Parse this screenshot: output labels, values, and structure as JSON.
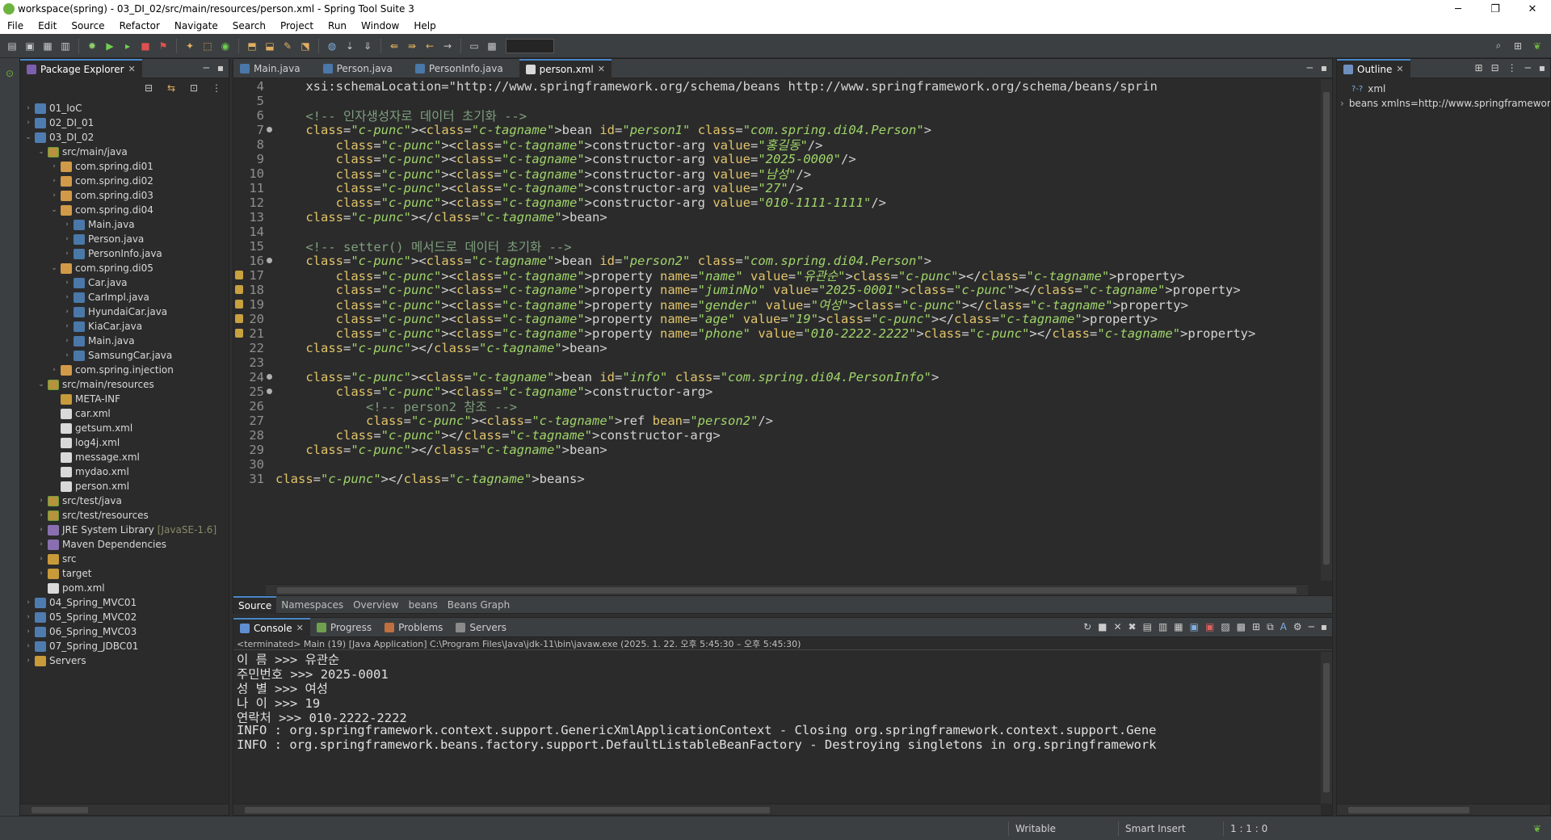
{
  "window": {
    "title": "workspace(spring) - 03_DI_02/src/main/resources/person.xml - Spring Tool Suite 3",
    "minimize": "─",
    "maximize": "❐",
    "close": "✕"
  },
  "menu": [
    "File",
    "Edit",
    "Source",
    "Refactor",
    "Navigate",
    "Search",
    "Project",
    "Run",
    "Window",
    "Help"
  ],
  "package_explorer": {
    "title": "Package Explorer",
    "tree": [
      {
        "label": "01_IoC",
        "icon": "project-icon",
        "twisty": "›"
      },
      {
        "label": "02_DI_01",
        "icon": "project-icon",
        "twisty": "›"
      },
      {
        "label": "03_DI_02",
        "icon": "project-icon",
        "twisty": "⌄"
      },
      {
        "label": "src/main/java",
        "icon": "source-folder-icon",
        "twisty": "⌄"
      },
      {
        "label": "com.spring.di01",
        "icon": "package-icon",
        "twisty": "›"
      },
      {
        "label": "com.spring.di02",
        "icon": "package-icon",
        "twisty": "›"
      },
      {
        "label": "com.spring.di03",
        "icon": "package-icon",
        "twisty": "›"
      },
      {
        "label": "com.spring.di04",
        "icon": "package-icon",
        "twisty": "⌄"
      },
      {
        "label": "Main.java",
        "icon": "java-file-icon",
        "twisty": "›"
      },
      {
        "label": "Person.java",
        "icon": "java-file-icon",
        "twisty": "›"
      },
      {
        "label": "PersonInfo.java",
        "icon": "java-file-icon",
        "twisty": "›"
      },
      {
        "label": "com.spring.di05",
        "icon": "package-icon",
        "twisty": "⌄"
      },
      {
        "label": "Car.java",
        "icon": "java-file-icon",
        "twisty": "›"
      },
      {
        "label": "CarImpl.java",
        "icon": "java-file-icon",
        "twisty": "›"
      },
      {
        "label": "HyundaiCar.java",
        "icon": "java-file-icon",
        "twisty": "›"
      },
      {
        "label": "KiaCar.java",
        "icon": "java-file-icon",
        "twisty": "›"
      },
      {
        "label": "Main.java",
        "icon": "java-file-icon",
        "twisty": "›"
      },
      {
        "label": "SamsungCar.java",
        "icon": "java-file-icon",
        "twisty": "›"
      },
      {
        "label": "com.spring.injection",
        "icon": "package-icon",
        "twisty": "›"
      },
      {
        "label": "src/main/resources",
        "icon": "source-folder-icon",
        "twisty": "⌄"
      },
      {
        "label": "META-INF",
        "icon": "folder-icon",
        "twisty": ""
      },
      {
        "label": "car.xml",
        "icon": "xml-file-icon",
        "twisty": ""
      },
      {
        "label": "getsum.xml",
        "icon": "xml-file-icon",
        "twisty": ""
      },
      {
        "label": "log4j.xml",
        "icon": "xml-file-icon",
        "twisty": ""
      },
      {
        "label": "message.xml",
        "icon": "xml-file-icon",
        "twisty": ""
      },
      {
        "label": "mydao.xml",
        "icon": "xml-file-icon",
        "twisty": ""
      },
      {
        "label": "person.xml",
        "icon": "xml-file-icon",
        "twisty": ""
      },
      {
        "label": "src/test/java",
        "icon": "source-folder-icon",
        "twisty": "›"
      },
      {
        "label": "src/test/resources",
        "icon": "source-folder-icon",
        "twisty": "›"
      },
      {
        "label": "JRE System Library",
        "suffix": "[JavaSE-1.6]",
        "icon": "library-icon",
        "twisty": "›"
      },
      {
        "label": "Maven Dependencies",
        "icon": "library-icon",
        "twisty": "›"
      },
      {
        "label": "src",
        "icon": "folder-icon",
        "twisty": "›"
      },
      {
        "label": "target",
        "icon": "folder-icon",
        "twisty": "›"
      },
      {
        "label": "pom.xml",
        "icon": "xml-file-icon",
        "twisty": ""
      },
      {
        "label": "04_Spring_MVC01",
        "icon": "project-icon",
        "twisty": "›"
      },
      {
        "label": "05_Spring_MVC02",
        "icon": "project-icon",
        "twisty": "›"
      },
      {
        "label": "06_Spring_MVC03",
        "icon": "project-icon",
        "twisty": "›"
      },
      {
        "label": "07_Spring_JDBC01",
        "icon": "project-icon",
        "twisty": "›"
      },
      {
        "label": "Servers",
        "icon": "folder-icon",
        "twisty": "›"
      }
    ]
  },
  "editor": {
    "tabs": [
      {
        "label": "Main.java",
        "icon": "java-file-icon",
        "active": false
      },
      {
        "label": "Person.java",
        "icon": "java-file-icon",
        "active": false
      },
      {
        "label": "PersonInfo.java",
        "icon": "java-file-icon",
        "active": false
      },
      {
        "label": "person.xml",
        "icon": "xml-file-icon",
        "active": true
      }
    ],
    "lines": [
      {
        "n": "4",
        "text": "    xsi:schemaLocation=\"http://www.springframework.org/schema/beans http://www.springframework.org/schema/beans/sprin"
      },
      {
        "n": "5",
        "text": ""
      },
      {
        "n": "6",
        "text": "    <!-- 인자생성자로 데이터 초기화 -->"
      },
      {
        "n": "7",
        "text": "    <bean id=\"person1\" class=\"com.spring.di04.Person\">"
      },
      {
        "n": "8",
        "text": "        <constructor-arg value=\"홍길동\"/>"
      },
      {
        "n": "9",
        "text": "        <constructor-arg value=\"2025-0000\"/>"
      },
      {
        "n": "10",
        "text": "        <constructor-arg value=\"남성\"/>"
      },
      {
        "n": "11",
        "text": "        <constructor-arg value=\"27\"/>"
      },
      {
        "n": "12",
        "text": "        <constructor-arg value=\"010-1111-1111\"/>"
      },
      {
        "n": "13",
        "text": "    </bean>"
      },
      {
        "n": "14",
        "text": ""
      },
      {
        "n": "15",
        "text": "    <!-- setter() 메서드로 데이터 초기화 -->"
      },
      {
        "n": "16",
        "text": "    <bean id=\"person2\" class=\"com.spring.di04.Person\">"
      },
      {
        "n": "17",
        "text": "        <property name=\"name\" value=\"유관순\"></property>"
      },
      {
        "n": "18",
        "text": "        <property name=\"juminNo\" value=\"2025-0001\"></property>"
      },
      {
        "n": "19",
        "text": "        <property name=\"gender\" value=\"여성\"></property>"
      },
      {
        "n": "20",
        "text": "        <property name=\"age\" value=\"19\"></property>"
      },
      {
        "n": "21",
        "text": "        <property name=\"phone\" value=\"010-2222-2222\"></property>"
      },
      {
        "n": "22",
        "text": "    </bean>"
      },
      {
        "n": "23",
        "text": ""
      },
      {
        "n": "24",
        "text": "    <bean id=\"info\" class=\"com.spring.di04.PersonInfo\">"
      },
      {
        "n": "25",
        "text": "        <constructor-arg>"
      },
      {
        "n": "26",
        "text": "            <!-- person2 참조 -->"
      },
      {
        "n": "27",
        "text": "            <ref bean=\"person2\"/>"
      },
      {
        "n": "28",
        "text": "        </constructor-arg>"
      },
      {
        "n": "29",
        "text": "    </bean>"
      },
      {
        "n": "30",
        "text": ""
      },
      {
        "n": "31",
        "text": "</beans>"
      }
    ],
    "subtabs": [
      "Source",
      "Namespaces",
      "Overview",
      "beans",
      "Beans Graph"
    ]
  },
  "outline": {
    "title": "Outline",
    "rows": [
      {
        "label": "xml",
        "prefix": "?-?"
      },
      {
        "label": "beans xmlns=http://www.springframewor",
        "prefix": "›"
      }
    ]
  },
  "console": {
    "tabs": [
      "Console",
      "Progress",
      "Problems",
      "Servers"
    ],
    "status": "<terminated> Main (19) [Java Application] C:\\Program Files\\Java\\jdk-11\\bin\\javaw.exe  (2025. 1. 22. 오후 5:45:30 – 오후 5:45:30)",
    "lines": [
      "이 름 >>> 유관순",
      "주민번호 >>> 2025-0001",
      "성 별 >>> 여성",
      "나 이 >>> 19",
      "연락처 >>> 010-2222-2222",
      "INFO : org.springframework.context.support.GenericXmlApplicationContext - Closing org.springframework.context.support.Gene",
      "INFO : org.springframework.beans.factory.support.DefaultListableBeanFactory - Destroying singletons in org.springframework"
    ]
  },
  "statusbar": {
    "mode": "Writable",
    "insert": "Smart Insert",
    "position": "1 : 1 : 0"
  }
}
